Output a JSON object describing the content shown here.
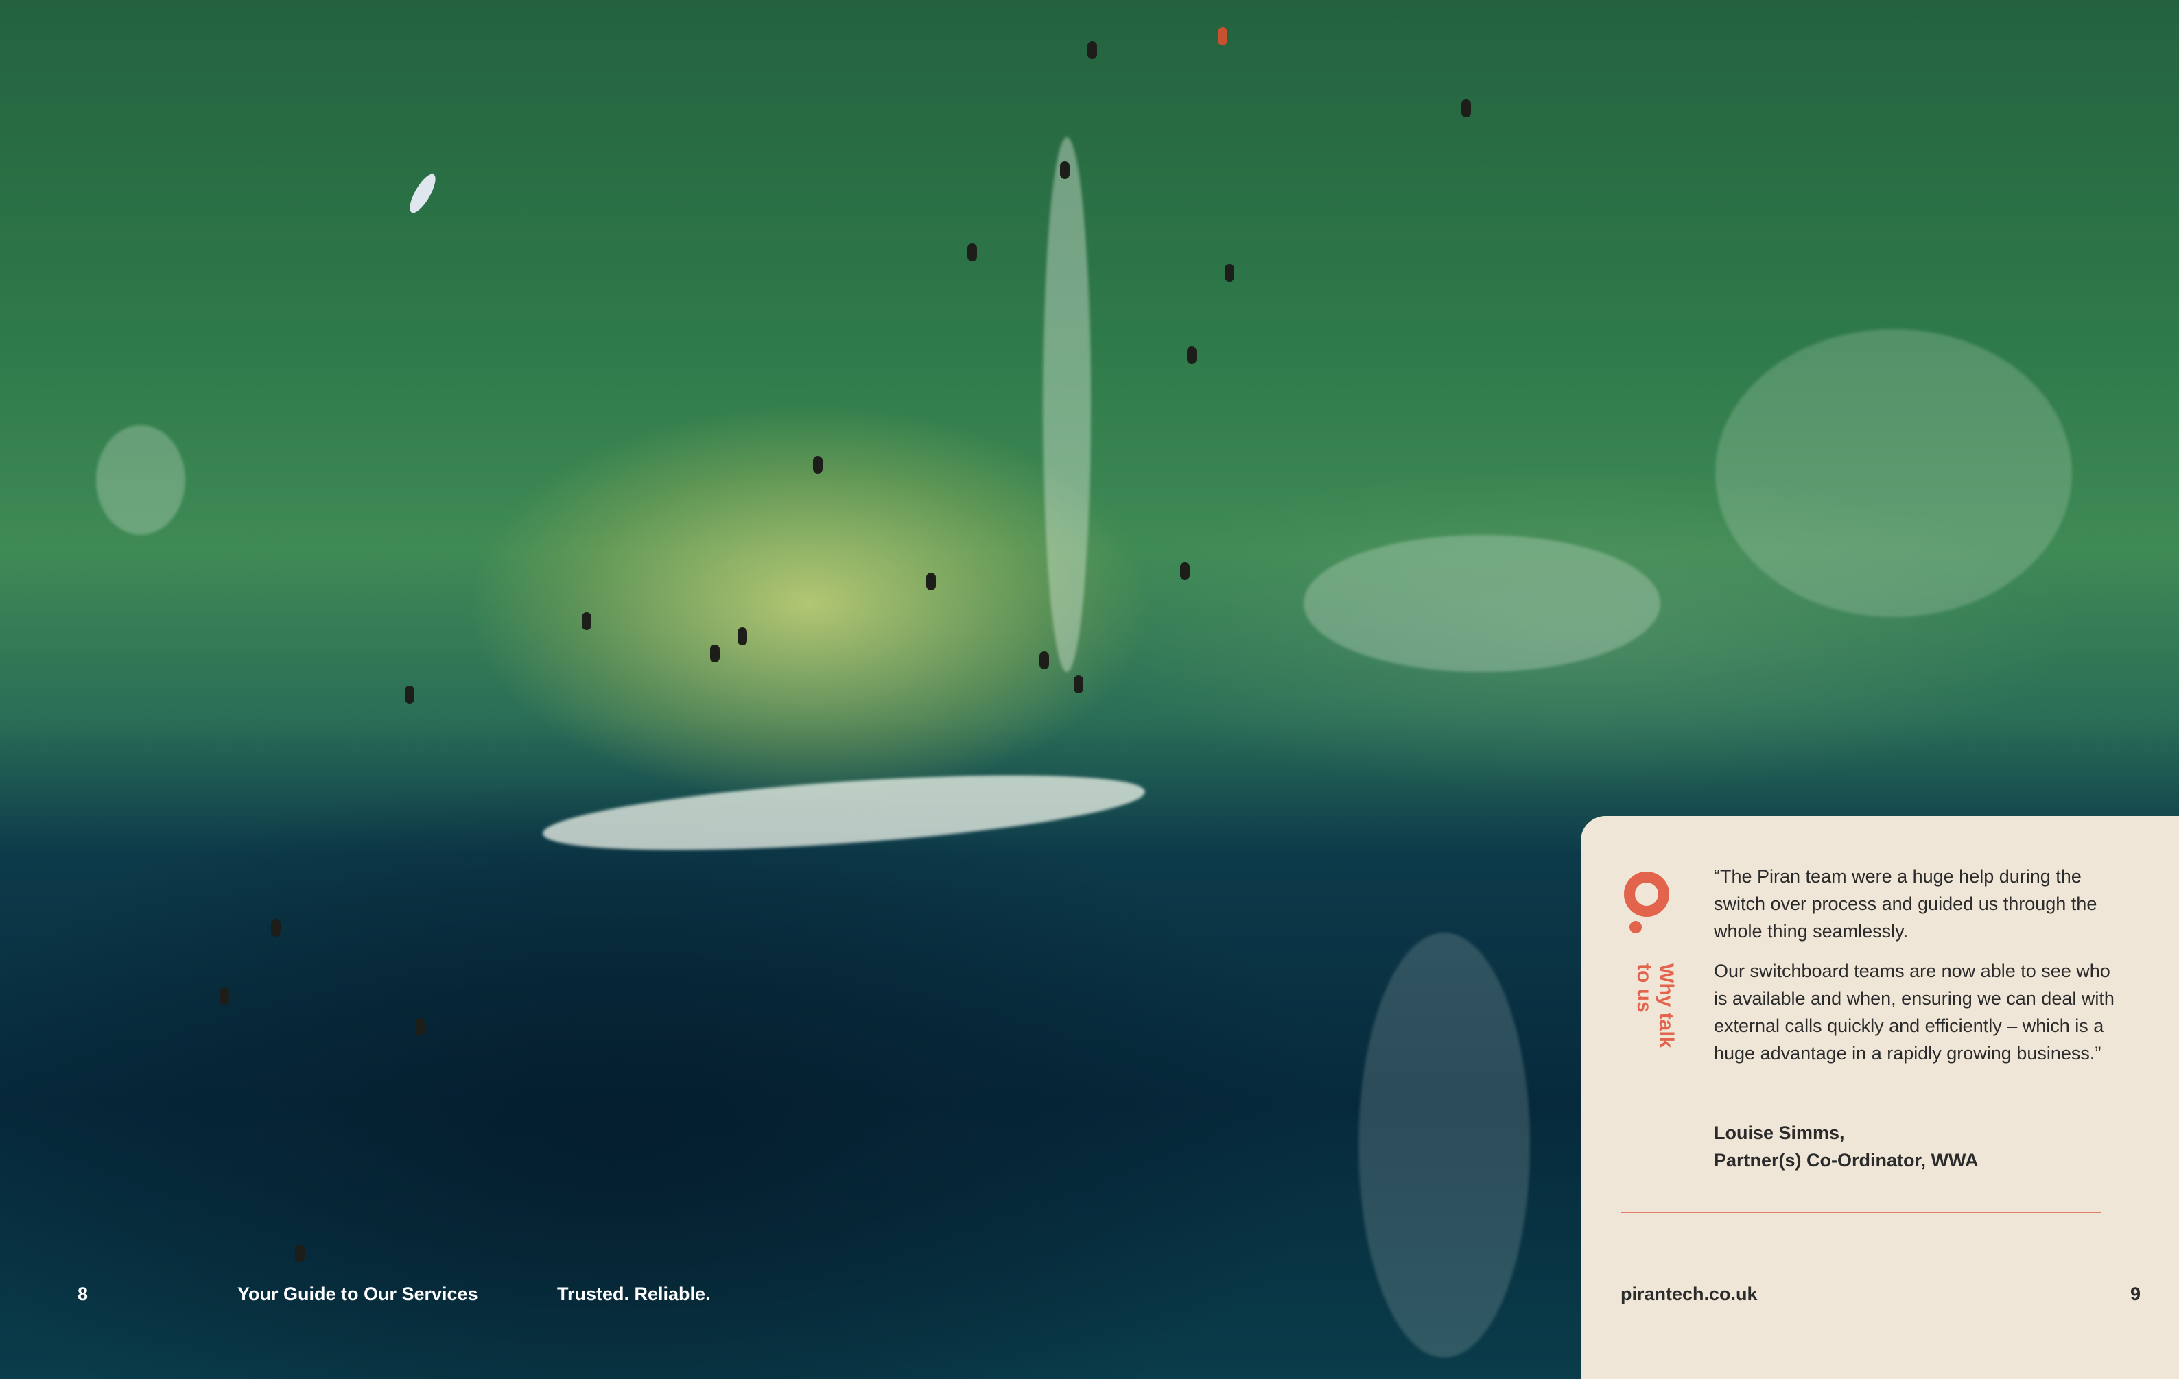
{
  "footer": {
    "page_left": "8",
    "guide_title": "Your Guide to Our Services",
    "tagline": "Trusted. Reliable."
  },
  "panel": {
    "side_label_line1": "Why talk",
    "side_label_line2": "to us",
    "quote_paragraph1": "“The Piran team were a huge help during the switch over process and guided us through the whole thing seamlessly.",
    "quote_paragraph2": "Our switchboard teams are now able to see who is available and when, ensuring we can deal with external calls quickly and efficiently – which is a huge advantage in a rapidly growing business.”",
    "attribution_name": "Louise Simms,",
    "attribution_role": "Partner(s) Co-Ordinator, WWA",
    "website": "pirantech.co.uk",
    "page_right": "9"
  },
  "colors": {
    "accent": "#e2644c",
    "panel_background": "#efe6d8",
    "text": "#2b2b2b"
  }
}
